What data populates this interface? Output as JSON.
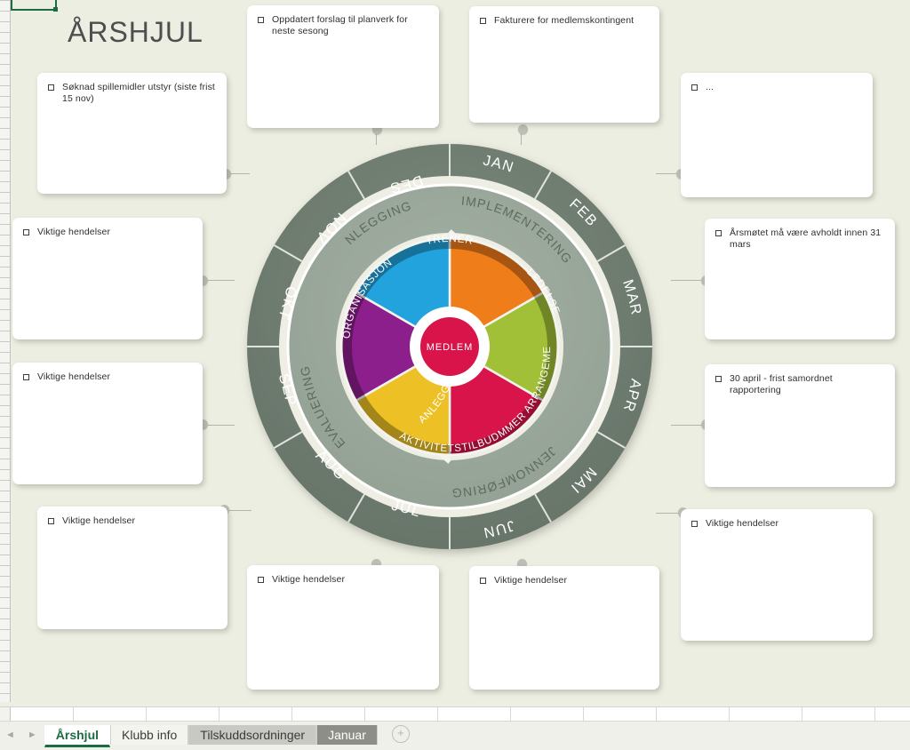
{
  "app": {
    "title": "ÅRSHJUL"
  },
  "tabbar": {
    "prev_arrow": "◄",
    "next_arrow": "►",
    "add_label": "+",
    "tabs": [
      {
        "label": "Årshjul",
        "state": "active"
      },
      {
        "label": "Klubb info",
        "state": "normal"
      },
      {
        "label": "Tilskuddsordninger",
        "state": "grey"
      },
      {
        "label": "Januar",
        "state": "dark"
      }
    ]
  },
  "wheel": {
    "center_label": "MEDLEM",
    "months": [
      "JAN",
      "FEB",
      "MAR",
      "APR",
      "MAI",
      "JUN",
      "JUL",
      "AUG",
      "SEP",
      "OKT",
      "NOV",
      "DES"
    ],
    "phases": [
      "IMPLEMENTERING",
      "GJENNOMFØRING",
      "EVALUERING",
      "PLANLEGGING"
    ],
    "sectors": [
      {
        "label": "TRENER",
        "color": "#ef7d1a"
      },
      {
        "label": "LEDELSE",
        "color": "#a2c037"
      },
      {
        "label": "DOMMER ARRANGEMENT",
        "color": "#d8144a"
      },
      {
        "label": "AKTIVITETSTILBUD",
        "color": "#edc025"
      },
      {
        "label": "ANLEGG",
        "color": "#8c1f8c"
      },
      {
        "label": "ORGANISASJON",
        "color": "#23a3dd"
      }
    ],
    "colors": {
      "outer_ring": "#6e7c6e",
      "mid_ring": "#9aa79a",
      "center": "#d8144a",
      "ring_stroke": "#ffffff"
    }
  },
  "notes": [
    {
      "id": "note-nov",
      "text": "Søknad spillemidler utstyr (siste frist 15 nov)"
    },
    {
      "id": "note-des",
      "text": "Oppdatert forslag til planverk for neste sesong"
    },
    {
      "id": "note-jan",
      "text": "Fakturere for medlemskontingent"
    },
    {
      "id": "note-feb",
      "text": "..."
    },
    {
      "id": "note-okt",
      "text": "Viktige hendelser"
    },
    {
      "id": "note-mar",
      "text": "Årsmøtet må være avholdt innen 31 mars"
    },
    {
      "id": "note-sep",
      "text": "Viktige hendelser"
    },
    {
      "id": "note-apr",
      "text": "30 april - frist samordnet rapportering"
    },
    {
      "id": "note-aug",
      "text": "Viktige hendelser"
    },
    {
      "id": "note-mai",
      "text": "Viktige hendelser"
    },
    {
      "id": "note-jul",
      "text": "Viktige hendelser"
    },
    {
      "id": "note-jun",
      "text": "Viktige hendelser"
    }
  ]
}
